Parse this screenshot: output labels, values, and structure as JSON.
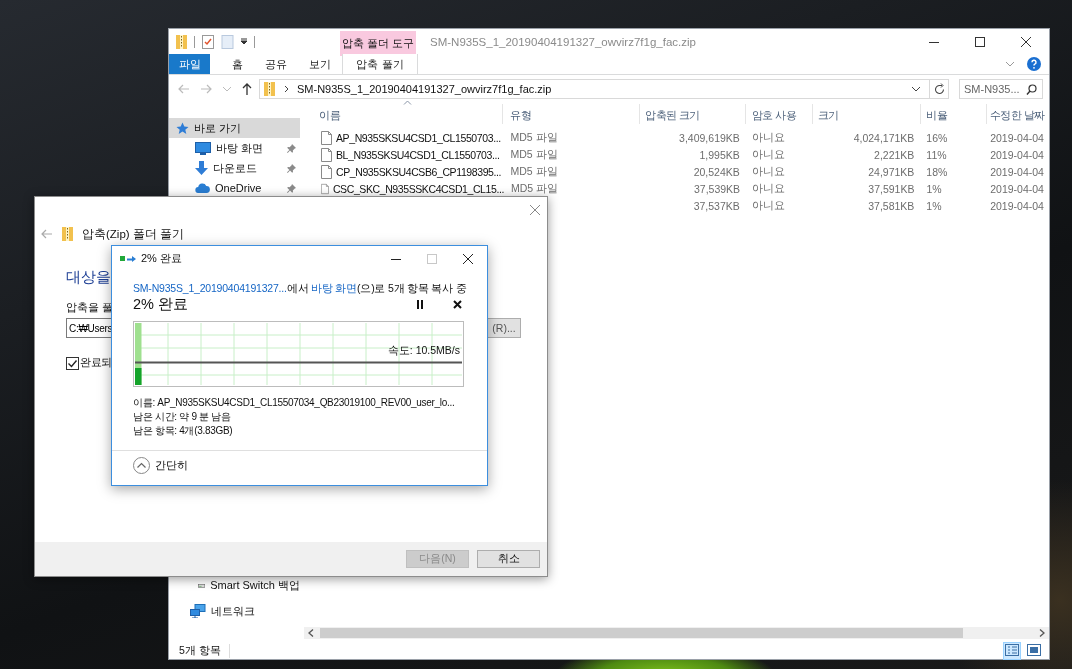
{
  "explorer": {
    "title": "SM-N935S_1_20190404191327_owvirz7f1g_fac.zip",
    "contextual_tab": "압축 폴더 도구",
    "ribbon_tabs": [
      {
        "label": "파일",
        "kind": "file"
      },
      {
        "label": "홈",
        "kind": "tab"
      },
      {
        "label": "공유",
        "kind": "tab"
      },
      {
        "label": "보기",
        "kind": "tab"
      },
      {
        "label": "압축 풀기",
        "kind": "contextual"
      }
    ],
    "address": {
      "path": "SM-N935S_1_20190404191327_owvirz7f1g_fac.zip"
    },
    "search": {
      "placeholder": "SM-N935..."
    },
    "nav": {
      "quick_access": {
        "label": "바로 가기",
        "selected": true,
        "children": [
          {
            "label": "바탕 화면",
            "kind": "desktop",
            "pinned": true,
            "selected": false
          },
          {
            "label": "다운로드",
            "kind": "download",
            "pinned": true,
            "selected": false
          },
          {
            "label": "OneDrive",
            "kind": "cloud",
            "pinned": true,
            "selected": false
          }
        ]
      },
      "lower_items": [
        {
          "label": "Smart Switch 백업",
          "kind": "drive",
          "selected": false
        },
        {
          "label": "네트워크",
          "kind": "network",
          "selected": false
        }
      ]
    },
    "columns": [
      {
        "label": "이름",
        "sorted": true
      },
      {
        "label": "유형",
        "sorted": false
      },
      {
        "label": "압축된 크기",
        "sorted": false
      },
      {
        "label": "암호 사용",
        "sorted": false
      },
      {
        "label": "크기",
        "sorted": false
      },
      {
        "label": "비율",
        "sorted": false
      },
      {
        "label": "수정한 날짜",
        "sorted": false
      }
    ],
    "rows": [
      {
        "name": "AP_N935SKSU4CSD1_CL1550703...",
        "type": "MD5 파일",
        "compressed": "3,409,619KB",
        "password": "아니요",
        "size": "4,024,171KB",
        "ratio": "16%",
        "modified": "2019-04-04"
      },
      {
        "name": "BL_N935SKSU4CSD1_CL1550703...",
        "type": "MD5 파일",
        "compressed": "1,995KB",
        "password": "아니요",
        "size": "2,221KB",
        "ratio": "11%",
        "modified": "2019-04-04"
      },
      {
        "name": "CP_N935SKSU4CSB6_CP1198395...",
        "type": "MD5 파일",
        "compressed": "20,524KB",
        "password": "아니요",
        "size": "24,971KB",
        "ratio": "18%",
        "modified": "2019-04-04"
      },
      {
        "name": "CSC_SKC_N935SSKC4CSD1_CL15...",
        "type": "MD5 파일",
        "compressed": "37,539KB",
        "password": "아니요",
        "size": "37,591KB",
        "ratio": "1%",
        "modified": "2019-04-04"
      },
      {
        "compressed": "37,537KB",
        "password": "아니요",
        "size": "37,581KB",
        "ratio": "1%",
        "modified": "2019-04-04"
      }
    ],
    "status": "5개 항목",
    "views": [
      {
        "kind": "details",
        "selected": true
      },
      {
        "kind": "large_icons",
        "selected": false
      }
    ]
  },
  "wizard": {
    "title": "압축(Zip) 폴더 풀기",
    "heading": "대상을",
    "path_label": "압축을 풀",
    "path_value": "C:₩Users",
    "browse": "(R)...",
    "checkbox": {
      "label": "완료되",
      "checked": true
    },
    "buttons": [
      {
        "label": "다음(N)",
        "disabled": true
      },
      {
        "label": "취소",
        "disabled": false
      }
    ]
  },
  "progress": {
    "title": "2% 완료",
    "window_controls": [
      {
        "kind": "minimize",
        "disabled": false
      },
      {
        "kind": "maximize",
        "disabled": true
      },
      {
        "kind": "close",
        "disabled": false
      }
    ],
    "status_line": {
      "source": "SM-N935S_1_20190404191327...",
      "from": "에서 ",
      "destination": "바탕 화면",
      "rest": "(으)로 5개 항목 복사 중"
    },
    "heading": "2% 완료",
    "level": 0.02,
    "speed": "속도: 10.5MB/s",
    "details": [
      "이름: AP_N935SKSU4CSD1_CL15507034_QB23019100_REV00_user_lo...",
      "남은 시간: 약 9 분 남음",
      "남은 항목: 4개(3.83GB)"
    ],
    "toggle": "간단히"
  }
}
